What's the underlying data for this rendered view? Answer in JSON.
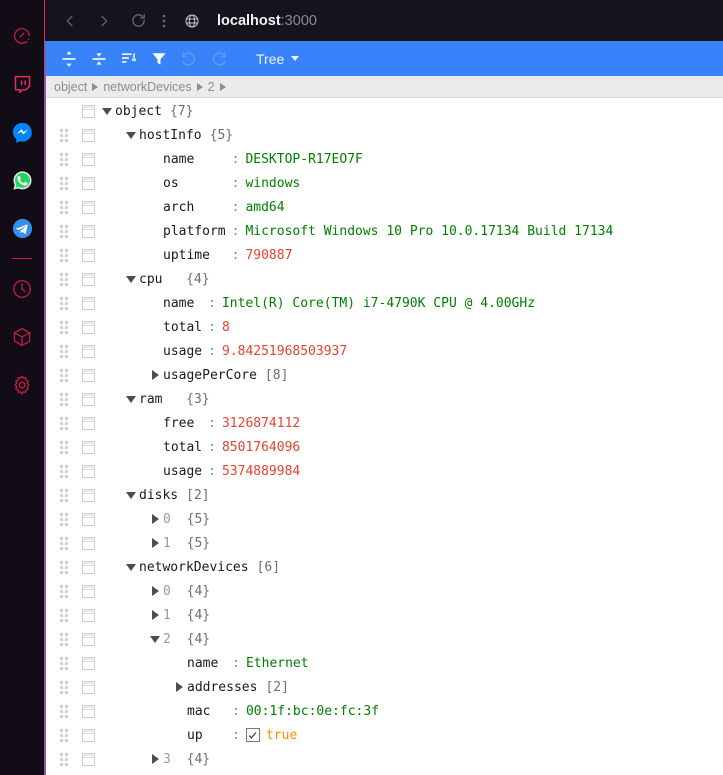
{
  "rail": {
    "items": [
      {
        "name": "ferdi-logo-icon",
        "label": "Ferdi"
      },
      {
        "name": "twitch-icon",
        "label": "Twitch"
      },
      {
        "name": "messenger-icon",
        "label": "Messenger"
      },
      {
        "name": "whatsapp-icon",
        "label": "WhatsApp"
      },
      {
        "name": "telegram-icon",
        "label": "Telegram"
      },
      {
        "name": "divider",
        "label": ""
      },
      {
        "name": "clock-icon",
        "label": "Clock"
      },
      {
        "name": "cube-icon",
        "label": "Workspaces"
      },
      {
        "name": "gear-icon",
        "label": "Settings"
      }
    ]
  },
  "browser": {
    "back_label": "Back",
    "forward_label": "Forward",
    "reload_label": "Reload",
    "menu_label": "More",
    "url_host": "localhost",
    "url_port": ":3000"
  },
  "editor": {
    "toolbar": {
      "expand_all": "Expand all fields",
      "collapse_all": "Collapse all fields",
      "sort": "Sort contents",
      "filter": "Filter, sort, or transform contents",
      "undo": "Undo last action",
      "redo": "Redo",
      "mode_label": "Tree"
    },
    "breadcrumb": [
      "object",
      "networkDevices",
      "2"
    ],
    "tree": [
      {
        "indent": 0,
        "drag": false,
        "toggle": "down",
        "key": "object",
        "type": "count",
        "value": "{7}"
      },
      {
        "indent": 1,
        "drag": true,
        "toggle": "down",
        "key": "hostInfo",
        "type": "count",
        "value": "{5}"
      },
      {
        "indent": 2,
        "drag": true,
        "toggle": "none",
        "key": "name",
        "keypad": "name    ",
        "type": "string",
        "value": "DESKTOP-R17EO7F"
      },
      {
        "indent": 2,
        "drag": true,
        "toggle": "none",
        "key": "os",
        "keypad": "os      ",
        "type": "string",
        "value": "windows"
      },
      {
        "indent": 2,
        "drag": true,
        "toggle": "none",
        "key": "arch",
        "keypad": "arch    ",
        "type": "string",
        "value": "amd64"
      },
      {
        "indent": 2,
        "drag": true,
        "toggle": "none",
        "key": "platform",
        "keypad": "platform",
        "type": "string",
        "value": "Microsoft Windows 10 Pro 10.0.17134 Build 17134"
      },
      {
        "indent": 2,
        "drag": true,
        "toggle": "none",
        "key": "uptime",
        "keypad": "uptime  ",
        "type": "number",
        "value": "790887"
      },
      {
        "indent": 1,
        "drag": true,
        "toggle": "down",
        "key": "cpu",
        "keypad": "cpu  ",
        "type": "count",
        "value": "{4}"
      },
      {
        "indent": 2,
        "drag": true,
        "toggle": "none",
        "key": "name",
        "keypad": "name ",
        "type": "string",
        "value": "Intel(R) Core(TM) i7-4790K CPU @ 4.00GHz"
      },
      {
        "indent": 2,
        "drag": true,
        "toggle": "none",
        "key": "total",
        "keypad": "total",
        "type": "number",
        "value": "8"
      },
      {
        "indent": 2,
        "drag": true,
        "toggle": "none",
        "key": "usage",
        "keypad": "usage",
        "type": "number",
        "value": "9.84251968503937"
      },
      {
        "indent": 2,
        "drag": true,
        "toggle": "right",
        "key": "usagePerCore",
        "type": "count",
        "value": "[8]"
      },
      {
        "indent": 1,
        "drag": true,
        "toggle": "down",
        "key": "ram",
        "keypad": "ram  ",
        "type": "count",
        "value": "{3}"
      },
      {
        "indent": 2,
        "drag": true,
        "toggle": "none",
        "key": "free",
        "keypad": "free ",
        "type": "number",
        "value": "3126874112"
      },
      {
        "indent": 2,
        "drag": true,
        "toggle": "none",
        "key": "total",
        "keypad": "total",
        "type": "number",
        "value": "8501764096"
      },
      {
        "indent": 2,
        "drag": true,
        "toggle": "none",
        "key": "usage",
        "keypad": "usage",
        "type": "number",
        "value": "5374889984"
      },
      {
        "indent": 1,
        "drag": true,
        "toggle": "down",
        "key": "disks",
        "type": "count",
        "value": "[2]"
      },
      {
        "indent": 2,
        "drag": true,
        "toggle": "right",
        "key": "0",
        "isIndex": true,
        "keypad": "0 ",
        "type": "count",
        "value": "{5}"
      },
      {
        "indent": 2,
        "drag": true,
        "toggle": "right",
        "key": "1",
        "isIndex": true,
        "keypad": "1 ",
        "type": "count",
        "value": "{5}"
      },
      {
        "indent": 1,
        "drag": true,
        "toggle": "down",
        "key": "networkDevices",
        "type": "count",
        "value": "[6]"
      },
      {
        "indent": 2,
        "drag": true,
        "toggle": "right",
        "key": "0",
        "isIndex": true,
        "keypad": "0 ",
        "type": "count",
        "value": "{4}"
      },
      {
        "indent": 2,
        "drag": true,
        "toggle": "right",
        "key": "1",
        "isIndex": true,
        "keypad": "1 ",
        "type": "count",
        "value": "{4}"
      },
      {
        "indent": 2,
        "drag": true,
        "toggle": "down",
        "key": "2",
        "isIndex": true,
        "keypad": "2 ",
        "type": "count",
        "value": "{4}"
      },
      {
        "indent": 3,
        "drag": true,
        "toggle": "none",
        "key": "name",
        "keypad": "name ",
        "type": "string",
        "value": "Ethernet"
      },
      {
        "indent": 3,
        "drag": true,
        "toggle": "right",
        "key": "addresses",
        "type": "count",
        "value": "[2]"
      },
      {
        "indent": 3,
        "drag": true,
        "toggle": "none",
        "key": "mac",
        "keypad": "mac  ",
        "type": "string",
        "value": "00:1f:bc:0e:fc:3f"
      },
      {
        "indent": 3,
        "drag": true,
        "toggle": "none",
        "key": "up",
        "keypad": "up   ",
        "type": "boolean",
        "value": "true",
        "checked": true
      },
      {
        "indent": 2,
        "drag": true,
        "toggle": "right",
        "key": "3",
        "isIndex": true,
        "keypad": "3 ",
        "type": "count",
        "value": "{4}"
      }
    ]
  },
  "colors": {
    "accent": "#3883fa",
    "rail_bg": "#120c17",
    "rail_border": "#e62e5c",
    "string": "#008000",
    "number": "#e8422e",
    "boolean": "#ff8c00"
  }
}
